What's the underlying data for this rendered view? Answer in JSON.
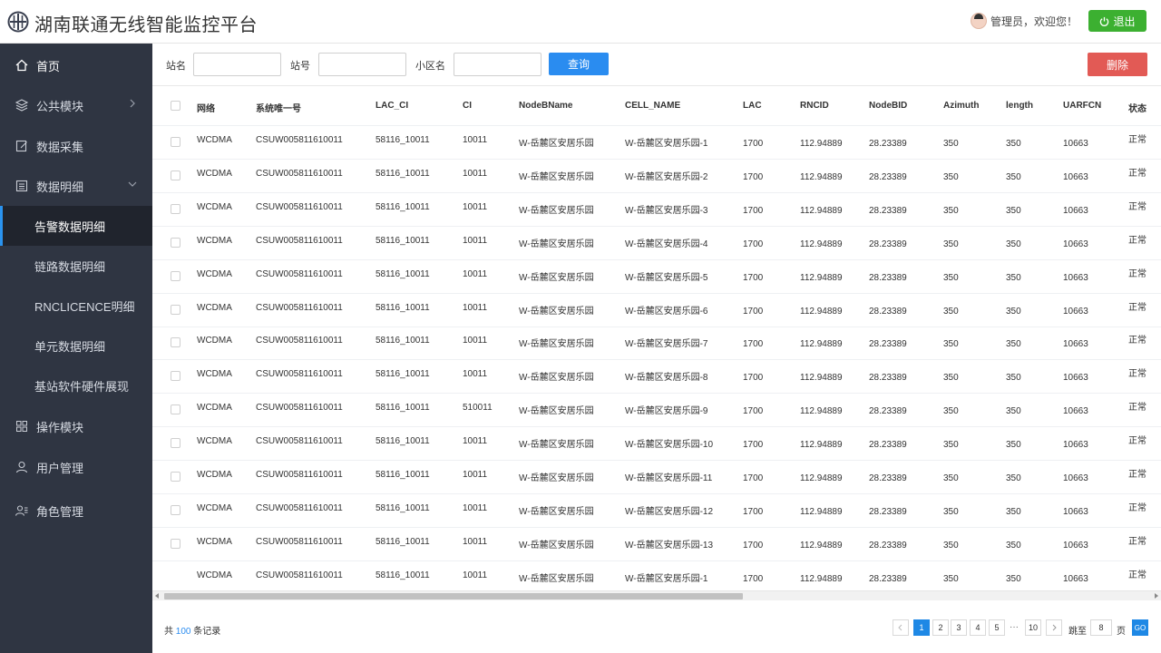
{
  "header": {
    "title": "湖南联通无线智能监控平台",
    "user_text": "管理员，欢迎您！",
    "logout_label": "退出"
  },
  "sidebar": {
    "items": [
      {
        "label": "首页",
        "icon": "home-icon"
      },
      {
        "label": "公共模块",
        "icon": "layers-icon"
      },
      {
        "label": "数据采集",
        "icon": "edit-icon"
      },
      {
        "label": "数据明细",
        "icon": "list-icon"
      },
      {
        "label": "操作模块",
        "icon": "grid-icon"
      },
      {
        "label": "用户管理",
        "icon": "user-icon"
      },
      {
        "label": "角色管理",
        "icon": "role-icon"
      }
    ],
    "subitems": [
      {
        "label": "告警数据明细",
        "active": true
      },
      {
        "label": "链路数据明细"
      },
      {
        "label": "RNCLICENCE明细"
      },
      {
        "label": "单元数据明细"
      },
      {
        "label": "基站软件硬件展现"
      }
    ]
  },
  "filter": {
    "site_name_label": "站名",
    "site_no_label": "站号",
    "cell_name_label": "小区名",
    "query_label": "查询",
    "delete_label": "删除"
  },
  "table": {
    "columns": [
      "网络",
      "系统唯一号",
      "LAC_CI",
      "CI",
      "NodeBName",
      "CELL_NAME",
      "LAC",
      "RNCID",
      "NodeBID",
      "Azimuth",
      "length",
      "UARFCN",
      "状态"
    ],
    "rows": [
      [
        "WCDMA",
        "CSUW005811610011",
        "58116_10011",
        "10011",
        "W-岳麓区安居乐园",
        "W-岳麓区安居乐园-1",
        "1700",
        "112.94889",
        "28.23389",
        "350",
        "350",
        "10663",
        "正常"
      ],
      [
        "WCDMA",
        "CSUW005811610011",
        "58116_10011",
        "10011",
        "W-岳麓区安居乐园",
        "W-岳麓区安居乐园-2",
        "1700",
        "112.94889",
        "28.23389",
        "350",
        "350",
        "10663",
        "正常"
      ],
      [
        "WCDMA",
        "CSUW005811610011",
        "58116_10011",
        "10011",
        "W-岳麓区安居乐园",
        "W-岳麓区安居乐园-3",
        "1700",
        "112.94889",
        "28.23389",
        "350",
        "350",
        "10663",
        "正常"
      ],
      [
        "WCDMA",
        "CSUW005811610011",
        "58116_10011",
        "10011",
        "W-岳麓区安居乐园",
        "W-岳麓区安居乐园-4",
        "1700",
        "112.94889",
        "28.23389",
        "350",
        "350",
        "10663",
        "正常"
      ],
      [
        "WCDMA",
        "CSUW005811610011",
        "58116_10011",
        "10011",
        "W-岳麓区安居乐园",
        "W-岳麓区安居乐园-5",
        "1700",
        "112.94889",
        "28.23389",
        "350",
        "350",
        "10663",
        "正常"
      ],
      [
        "WCDMA",
        "CSUW005811610011",
        "58116_10011",
        "10011",
        "W-岳麓区安居乐园",
        "W-岳麓区安居乐园-6",
        "1700",
        "112.94889",
        "28.23389",
        "350",
        "350",
        "10663",
        "正常"
      ],
      [
        "WCDMA",
        "CSUW005811610011",
        "58116_10011",
        "10011",
        "W-岳麓区安居乐园",
        "W-岳麓区安居乐园-7",
        "1700",
        "112.94889",
        "28.23389",
        "350",
        "350",
        "10663",
        "正常"
      ],
      [
        "WCDMA",
        "CSUW005811610011",
        "58116_10011",
        "10011",
        "W-岳麓区安居乐园",
        "W-岳麓区安居乐园-8",
        "1700",
        "112.94889",
        "28.23389",
        "350",
        "350",
        "10663",
        "正常"
      ],
      [
        "WCDMA",
        "CSUW005811610011",
        "58116_10011",
        "510011",
        "W-岳麓区安居乐园",
        "W-岳麓区安居乐园-9",
        "1700",
        "112.94889",
        "28.23389",
        "350",
        "350",
        "10663",
        "正常"
      ],
      [
        "WCDMA",
        "CSUW005811610011",
        "58116_10011",
        "10011",
        "W-岳麓区安居乐园",
        "W-岳麓区安居乐园-10",
        "1700",
        "112.94889",
        "28.23389",
        "350",
        "350",
        "10663",
        "正常"
      ],
      [
        "WCDMA",
        "CSUW005811610011",
        "58116_10011",
        "10011",
        "W-岳麓区安居乐园",
        "W-岳麓区安居乐园-11",
        "1700",
        "112.94889",
        "28.23389",
        "350",
        "350",
        "10663",
        "正常"
      ],
      [
        "WCDMA",
        "CSUW005811610011",
        "58116_10011",
        "10011",
        "W-岳麓区安居乐园",
        "W-岳麓区安居乐园-12",
        "1700",
        "112.94889",
        "28.23389",
        "350",
        "350",
        "10663",
        "正常"
      ],
      [
        "WCDMA",
        "CSUW005811610011",
        "58116_10011",
        "10011",
        "W-岳麓区安居乐园",
        "W-岳麓区安居乐园-13",
        "1700",
        "112.94889",
        "28.23389",
        "350",
        "350",
        "10663",
        "正常"
      ],
      [
        "WCDMA",
        "CSUW005811610011",
        "58116_10011",
        "10011",
        "W-岳麓区安居乐园",
        "W-岳麓区安居乐园-1",
        "1700",
        "112.94889",
        "28.23389",
        "350",
        "350",
        "10663",
        "正常"
      ]
    ]
  },
  "footer": {
    "total_prefix": "共",
    "total_count": "100",
    "total_suffix": "条记录",
    "pages": [
      "1",
      "2",
      "3",
      "4",
      "5"
    ],
    "ellipsis": "···",
    "last_page": "10",
    "jump_label": "跳至",
    "jump_value": "8",
    "page_label": "页",
    "go_label": "GO"
  },
  "colors": {
    "sidebar_bg": "#2f3542",
    "accent": "#2a8cf0",
    "logout": "#3cb031",
    "delete": "#e25a55"
  }
}
